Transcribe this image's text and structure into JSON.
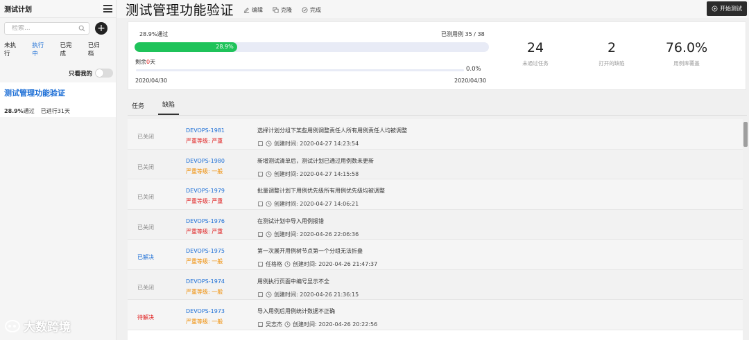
{
  "sidebar": {
    "title": "测试计划",
    "search_placeholder": "检索...",
    "add_label": "+",
    "tabs": [
      {
        "label": "未执行"
      },
      {
        "label": "执行中"
      },
      {
        "label": "已完成"
      },
      {
        "label": "已归档"
      }
    ],
    "toggle_label": "只看我的",
    "plan": {
      "name": "测试管理功能验证",
      "percent": "28.9%",
      "percent_suffix": "通过",
      "elapsed": "已进行31天"
    }
  },
  "header": {
    "title": "测试管理功能验证",
    "actions": [
      {
        "label": "编辑",
        "icon": "edit-icon"
      },
      {
        "label": "克隆",
        "icon": "clone-icon"
      },
      {
        "label": "完成",
        "icon": "check-icon"
      }
    ],
    "start_button": "开始测试"
  },
  "stats": {
    "pass_label": "28.9%通过",
    "cases_label": "已测用例 35 / 38",
    "progress_fraction": 0.289,
    "progress_text": "28.9%",
    "remain_prefix": "剩余",
    "remain_value": "0",
    "remain_suffix": "天",
    "time_pct": "0.0%",
    "start_date": "2020/04/30",
    "end_date": "2020/04/30",
    "items": [
      {
        "value": "24",
        "label": "未通过任务"
      },
      {
        "value": "2",
        "label": "打开的缺陷"
      },
      {
        "value": "76.0%",
        "label": "用例库覆盖"
      }
    ]
  },
  "tabs": [
    {
      "label": "任务"
    },
    {
      "label": "缺陷"
    }
  ],
  "defects": [
    {
      "status": "已关闭",
      "id": "DEVOPS-1981",
      "severity": "严重等级: 严重",
      "title": "选择计划分组下某些用例调整责任人所有用例责任人均被调整",
      "assignee": "",
      "created": "创建时间: 2020-04-27 14:23:54"
    },
    {
      "status": "已关闭",
      "id": "DEVOPS-1980",
      "severity": "严重等级: 一般",
      "title": "新增测试清单后，测试计划已通过用例数未更新",
      "assignee": "",
      "created": "创建时间: 2020-04-27 14:15:58"
    },
    {
      "status": "已关闭",
      "id": "DEVOPS-1979",
      "severity": "严重等级: 严重",
      "title": "批量调整计划下用例优先级所有用例优先级均被调整",
      "assignee": "",
      "created": "创建时间: 2020-04-27 14:06:21"
    },
    {
      "status": "已关闭",
      "id": "DEVOPS-1976",
      "severity": "严重等级: 严重",
      "title": "在测试计划中导入用例报错",
      "assignee": "",
      "created": "创建时间: 2020-04-26 22:06:36"
    },
    {
      "status": "已解决",
      "id": "DEVOPS-1975",
      "severity": "严重等级: 一般",
      "title": "第一次展开用例树节点第一个分组无法折叠",
      "assignee": "任格格",
      "created": "创建时间: 2020-04-26 21:47:37"
    },
    {
      "status": "已关闭",
      "id": "DEVOPS-1974",
      "severity": "严重等级: 一般",
      "title": "用例执行页面中编号显示不全",
      "assignee": "",
      "created": "创建时间: 2020-04-26 21:36:15"
    },
    {
      "status": "待解决",
      "id": "DEVOPS-1973",
      "severity": "严重等级: 一般",
      "title": "导入用例后用例统计数据不正确",
      "assignee": "吴志杰",
      "created": "创建时间: 2020-04-26 20:22:56"
    }
  ],
  "colors": {
    "accent": "#1d6fd6",
    "progress": "#1fc35a",
    "danger": "#e02020",
    "warning": "#f08c00"
  },
  "footer_logo": "大数跨境"
}
